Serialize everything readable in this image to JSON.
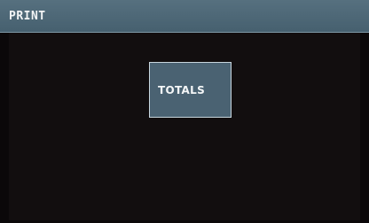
{
  "screen": {
    "title": "PRINT",
    "colors": {
      "header_bg": "#4f6978",
      "background": "#0b0809",
      "button_bg": "#4a6272",
      "button_border": "#c8d6de",
      "text": "#f2f4f5"
    }
  },
  "buttons": {
    "totals_label": "TOTALS"
  }
}
